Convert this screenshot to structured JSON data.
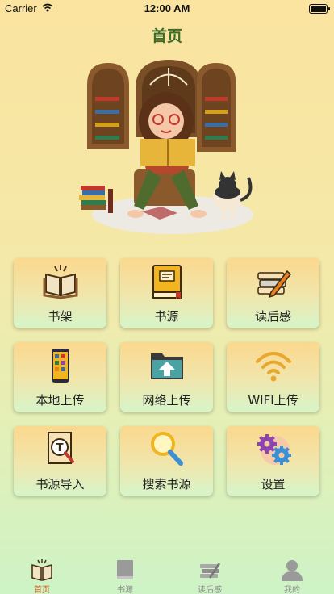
{
  "status_bar": {
    "carrier": "Carrier",
    "time": "12:00 AM"
  },
  "header": {
    "title": "首页"
  },
  "menu": [
    {
      "label": "书架",
      "icon": "open-book-icon"
    },
    {
      "label": "书源",
      "icon": "book-source-icon"
    },
    {
      "label": "读后感",
      "icon": "book-pencil-icon"
    },
    {
      "label": "本地上传",
      "icon": "phone-icon"
    },
    {
      "label": "网络上传",
      "icon": "folder-upload-icon"
    },
    {
      "label": "WIFI上传",
      "icon": "wifi-icon"
    },
    {
      "label": "书源导入",
      "icon": "text-search-icon"
    },
    {
      "label": "搜索书源",
      "icon": "magnifier-icon"
    },
    {
      "label": "设置",
      "icon": "gears-icon"
    }
  ],
  "tabbar": [
    {
      "label": "首页",
      "active": true,
      "icon": "home-book-icon"
    },
    {
      "label": "书源",
      "active": false,
      "icon": "book-icon"
    },
    {
      "label": "读后感",
      "active": false,
      "icon": "books-stack-icon"
    },
    {
      "label": "我的",
      "active": false,
      "icon": "user-icon"
    }
  ],
  "colors": {
    "title": "#3d6b2a",
    "tab_active": "#c35a1a",
    "tab_inactive": "#888888"
  }
}
